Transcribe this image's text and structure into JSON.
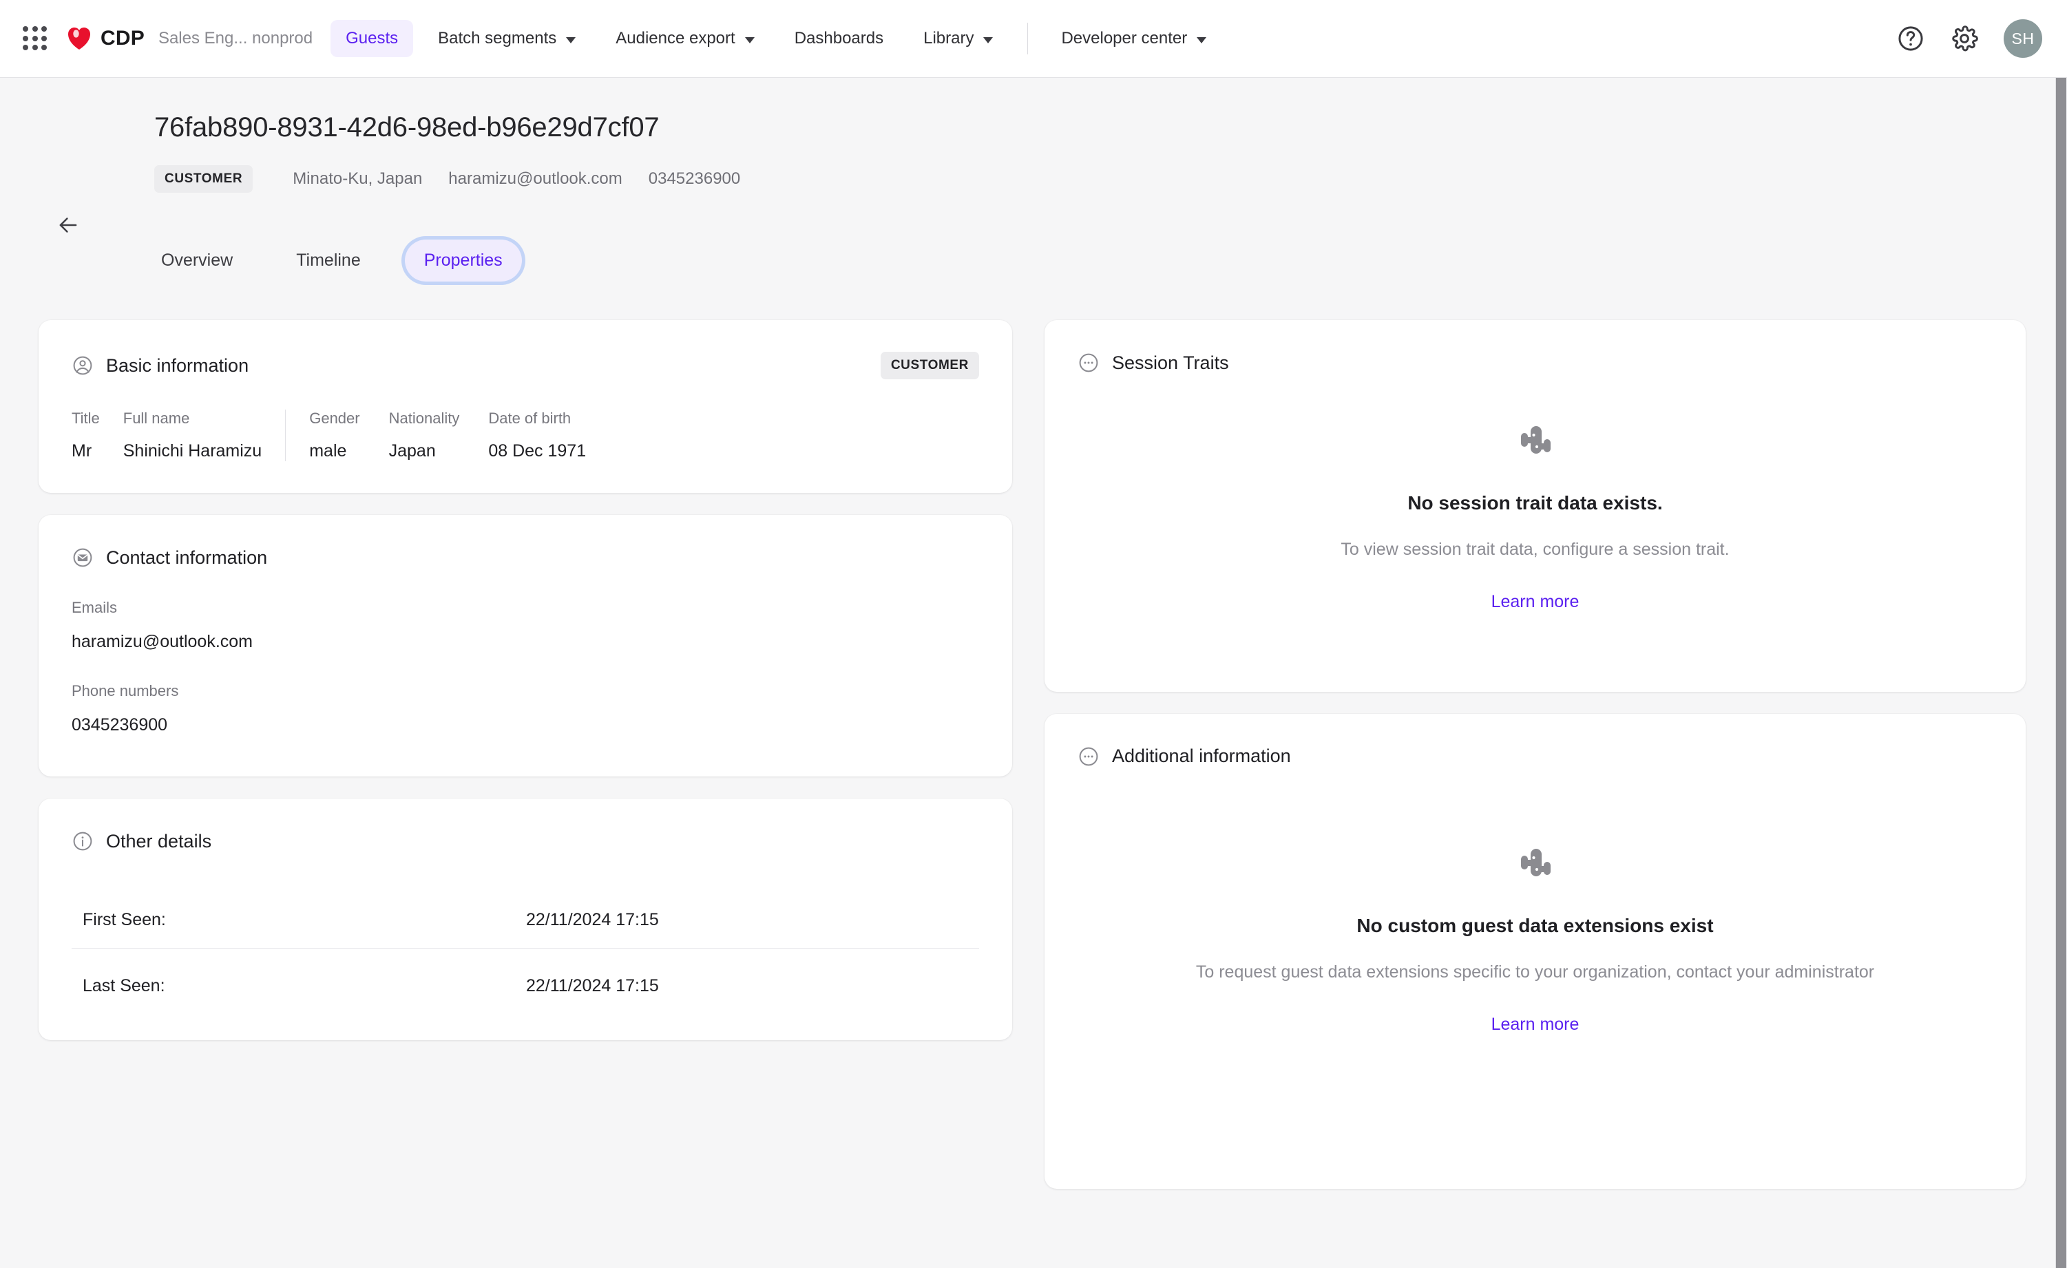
{
  "topnav": {
    "app_grid_icon": "apps-grid-icon",
    "brand": "CDP",
    "environment": "Sales Eng... nonprod",
    "items": [
      {
        "label": "Guests",
        "active": true,
        "caret": false
      },
      {
        "label": "Batch segments",
        "active": false,
        "caret": true
      },
      {
        "label": "Audience export",
        "active": false,
        "caret": true
      },
      {
        "label": "Dashboards",
        "active": false,
        "caret": false
      },
      {
        "label": "Library",
        "active": false,
        "caret": true
      },
      {
        "label": "Developer center",
        "active": false,
        "caret": true
      }
    ],
    "help_icon": "help-circle-icon",
    "settings_icon": "gear-icon",
    "avatar_initials": "SH"
  },
  "header": {
    "back_icon": "arrow-left-icon",
    "title": "76fab890-8931-42d6-98ed-b96e29d7cf07",
    "badge": "CUSTOMER",
    "location": "Minato-Ku, Japan",
    "email": "haramizu@outlook.com",
    "phone": "0345236900"
  },
  "tabs": [
    {
      "label": "Overview",
      "active": false
    },
    {
      "label": "Timeline",
      "active": false
    },
    {
      "label": "Properties",
      "active": true
    }
  ],
  "basic_information": {
    "icon": "user-circle-icon",
    "title": "Basic information",
    "badge": "CUSTOMER",
    "fields": [
      {
        "label": "Title",
        "value": "Mr"
      },
      {
        "label": "Full name",
        "value": "Shinichi Haramizu"
      },
      {
        "label": "Gender",
        "value": "male"
      },
      {
        "label": "Nationality",
        "value": "Japan"
      },
      {
        "label": "Date of birth",
        "value": "08 Dec 1971"
      }
    ]
  },
  "contact_information": {
    "icon": "envelope-circle-icon",
    "title": "Contact information",
    "emails_label": "Emails",
    "emails_value": "haramizu@outlook.com",
    "phones_label": "Phone numbers",
    "phones_value": "0345236900"
  },
  "other_details": {
    "icon": "info-circle-icon",
    "title": "Other details",
    "rows": [
      {
        "key": "First Seen:",
        "value": "22/11/2024 17:15"
      },
      {
        "key": "Last Seen:",
        "value": "22/11/2024 17:15"
      }
    ]
  },
  "session_traits": {
    "icon": "ellipsis-circle-icon",
    "title": "Session Traits",
    "empty_icon": "cactus-icon",
    "empty_title": "No session trait data exists.",
    "empty_sub": "To view session trait data, configure a session trait.",
    "link": "Learn more"
  },
  "additional_information": {
    "icon": "ellipsis-circle-icon",
    "title": "Additional information",
    "empty_icon": "cactus-icon",
    "empty_title": "No custom guest data extensions exist",
    "empty_sub": "To request guest data extensions specific to your organization, contact your administrator",
    "link": "Learn more"
  },
  "colors": {
    "accent": "#5b21f0",
    "accent_bg": "#f0ecfd",
    "focus_ring": "#c3d4f7",
    "page_bg": "#f6f6f7",
    "card_bg": "#ffffff",
    "muted_text": "#77777e",
    "brand_red": "#e8112d",
    "avatar_bg": "#8a9a9b"
  }
}
